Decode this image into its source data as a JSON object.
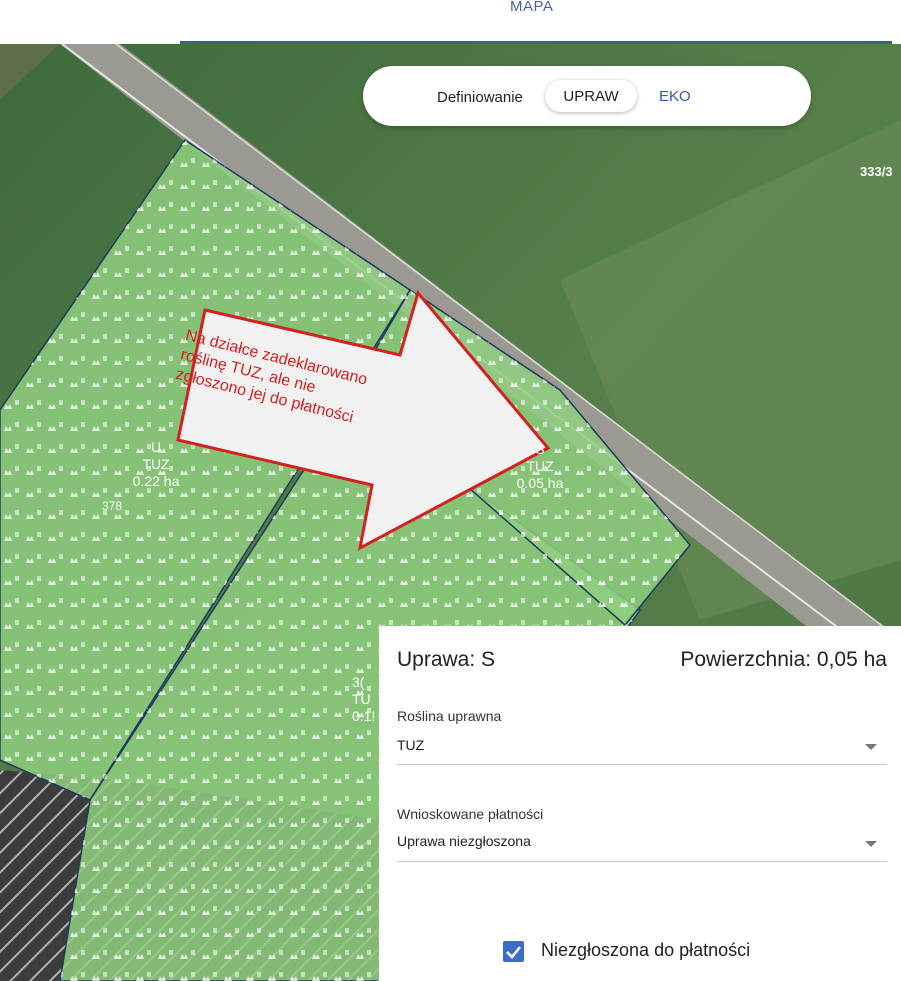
{
  "header": {
    "map_tab": "MAPA"
  },
  "toggle": {
    "label": "Definiowanie",
    "options": [
      "UPRAW",
      "EKO"
    ],
    "selected": "UPRAW"
  },
  "map": {
    "parcel_id": "333/3",
    "plots": [
      {
        "letter": "U",
        "crop": "TUZ",
        "area": "0.22 ha",
        "number": "378"
      },
      {
        "letter": "S",
        "crop": "TUZ",
        "area": "0.05 ha"
      },
      {
        "letter": "3(",
        "crop": "TU",
        "area": "0.1!"
      }
    ],
    "callout_lines": [
      "Na działce zadeklarowano",
      "roślinę TUZ, ale nie",
      "zgłoszono jej do płatności"
    ]
  },
  "panel": {
    "title": "Uprawa: S",
    "area": "Powierzchnia: 0,05 ha",
    "crop_field": {
      "label": "Roślina uprawna",
      "value": "TUZ"
    },
    "payment_field": {
      "label": "Wnioskowane płatności",
      "value": "Uprawa niezgłoszona"
    },
    "checkbox": {
      "label": "Niezgłoszona do płatności",
      "checked": true
    }
  },
  "colors": {
    "accent": "#3b6dc8",
    "callout_red": "#d42020",
    "plot_green": "#8fcf7f"
  }
}
